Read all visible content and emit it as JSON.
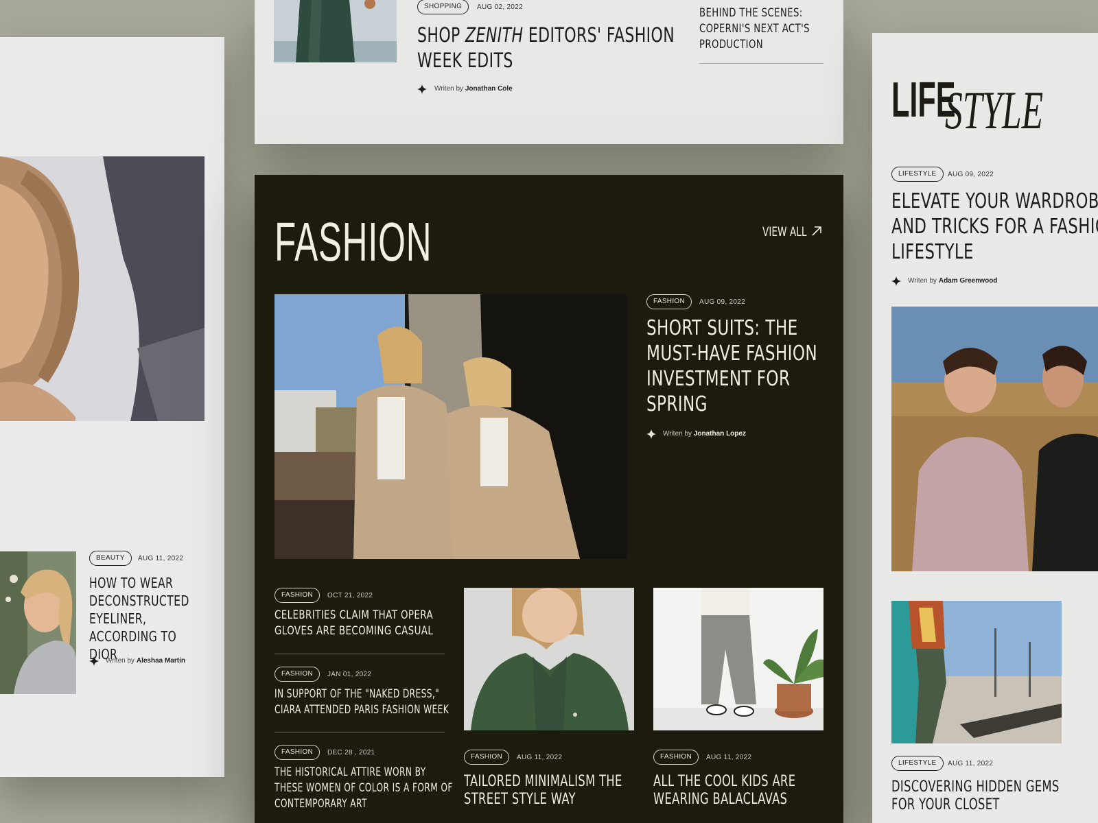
{
  "colors": {
    "page_bg": "#a8a99a",
    "dark_panel": "#1c1b0e",
    "light_panel": "#ebebeb",
    "accent_text": "#f0eee2"
  },
  "left": {
    "card": {
      "tag": "BEAUTY",
      "date": "AUG 11, 2022",
      "headline": [
        "HOW TO WEAR",
        "DECONSTRUCTED",
        "EYELINER,",
        "ACCORDING TO DIOR"
      ],
      "byline_prefix": "Writen by",
      "author": "Aleshaa Martin"
    }
  },
  "top": {
    "feature": {
      "tag": "SHOPPING",
      "date": "AUG 02, 2022",
      "headline_pre": "SHOP ",
      "headline_brand": "ZENITH",
      "headline_post": " EDITORS' FASHION",
      "headline_line2": "WEEK EDITS",
      "byline_prefix": "Writen by",
      "author": "Jonathan Cole"
    },
    "side": [
      "BEHIND THE SCENES:",
      "COPERNI'S NEXT ACT'S",
      "PRODUCTION"
    ]
  },
  "fashion": {
    "section_title": "FASHION",
    "view_all": "VIEW ALL",
    "feature": {
      "tag": "FASHION",
      "date": "AUG 09, 2022",
      "headline": [
        "SHORT SUITS: THE",
        "MUST-HAVE FASHION",
        "INVESTMENT FOR",
        "SPRING"
      ],
      "byline_prefix": "Writen by",
      "author": "Jonathan Lopez"
    },
    "list": [
      {
        "tag": "FASHION",
        "date": "OCT 21, 2022",
        "headline": [
          "CELEBRITIES CLAIM THAT OPERA",
          "GLOVES ARE BECOMING CASUAL"
        ]
      },
      {
        "tag": "FASHION",
        "date": "JAN 01, 2022",
        "headline": [
          "IN SUPPORT OF THE \"NAKED DRESS,\"",
          "CIARA ATTENDED PARIS FASHION WEEK"
        ]
      },
      {
        "tag": "FASHION",
        "date": "DEC 28 , 2021",
        "headline": [
          "THE HISTORICAL ATTIRE WORN BY",
          "THESE WOMEN OF COLOR IS A FORM OF",
          "CONTEMPORARY ART"
        ]
      }
    ],
    "cards": [
      {
        "tag": "FASHION",
        "date": "AUG 11, 2022",
        "headline": [
          "TAILORED MINIMALISM THE",
          "STREET STYLE WAY"
        ]
      },
      {
        "tag": "FASHION",
        "date": "AUG 11, 2022",
        "headline": [
          "ALL THE COOL KIDS ARE",
          "WEARING BALACLAVAS"
        ]
      }
    ]
  },
  "lifestyle": {
    "logo_upright": "LIFE",
    "logo_italic": "STYLE",
    "feature": {
      "tag": "LIFESTYLE",
      "date": "AUG 09, 2022",
      "headline": [
        "ELEVATE YOUR WARDROBE: T",
        "AND TRICKS FOR A FASHION",
        "LIFESTYLE"
      ],
      "byline_prefix": "Writen by",
      "author": "Adam Greenwood"
    },
    "card": {
      "tag": "LIFESTYLE",
      "date": "AUG 11, 2022",
      "headline": [
        "DISCOVERING HIDDEN GEMS",
        "FOR YOUR CLOSET"
      ]
    }
  }
}
